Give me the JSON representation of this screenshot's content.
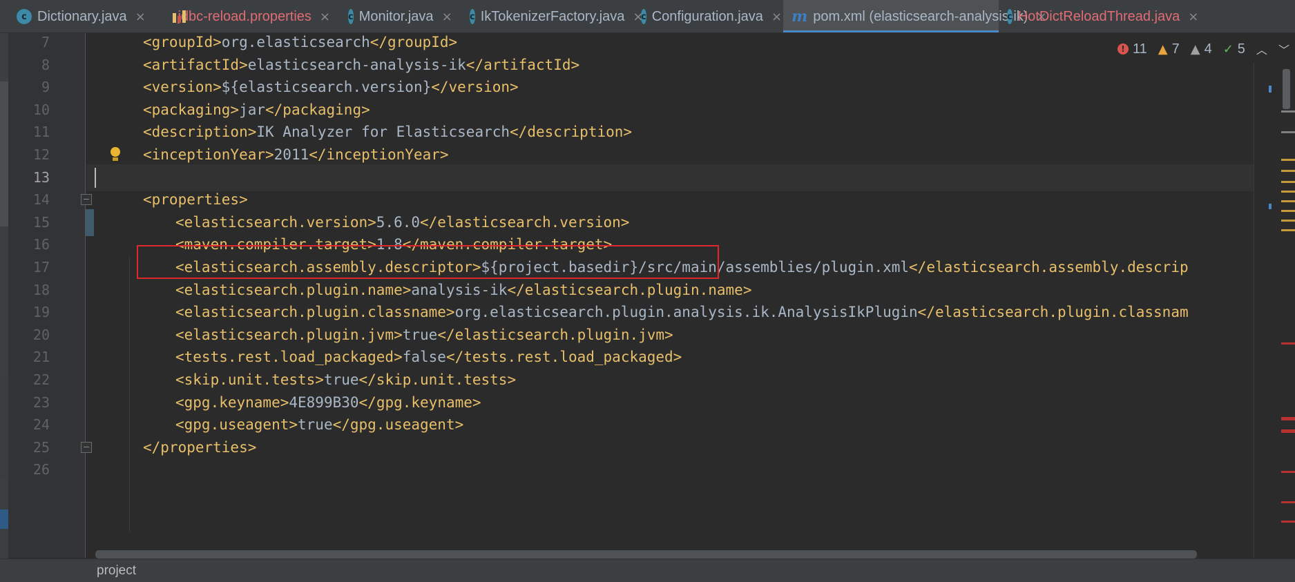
{
  "tabs": [
    {
      "label": "Dictionary.java",
      "icon": "class-icon",
      "active": false,
      "error": false
    },
    {
      "label": "jdbc-reload.properties",
      "icon": "properties-icon",
      "active": false,
      "error": true
    },
    {
      "label": "Monitor.java",
      "icon": "class-icon",
      "active": false,
      "error": false
    },
    {
      "label": "IkTokenizerFactory.java",
      "icon": "class-icon",
      "active": false,
      "error": false
    },
    {
      "label": "Configuration.java",
      "icon": "class-icon",
      "active": false,
      "error": false
    },
    {
      "label": "pom.xml (elasticsearch-analysis-ik)",
      "icon": "maven-icon",
      "active": true,
      "error": false
    },
    {
      "label": "HotDictReloadThread.java",
      "icon": "class-icon",
      "active": false,
      "error": true
    }
  ],
  "tab_close_glyph": "×",
  "inspections": {
    "errors": "11",
    "warnings": "7",
    "weak_warnings": "4",
    "ok": "5"
  },
  "editor": {
    "current_line": 13,
    "lines": [
      {
        "num": "7",
        "indent": 1,
        "parts": [
          [
            "tag",
            "<groupId>"
          ],
          [
            "txt",
            "org.elasticsearch"
          ],
          [
            "tag",
            "</groupId>"
          ]
        ]
      },
      {
        "num": "8",
        "indent": 1,
        "parts": [
          [
            "tag",
            "<artifactId>"
          ],
          [
            "txt",
            "elasticsearch-analysis-ik"
          ],
          [
            "tag",
            "</artifactId>"
          ]
        ]
      },
      {
        "num": "9",
        "indent": 1,
        "parts": [
          [
            "tag",
            "<version>"
          ],
          [
            "txt",
            "${elasticsearch.version}"
          ],
          [
            "tag",
            "</version>"
          ]
        ]
      },
      {
        "num": "10",
        "indent": 1,
        "parts": [
          [
            "tag",
            "<packaging>"
          ],
          [
            "txt",
            "jar"
          ],
          [
            "tag",
            "</packaging>"
          ]
        ]
      },
      {
        "num": "11",
        "indent": 1,
        "parts": [
          [
            "tag",
            "<description>"
          ],
          [
            "txt",
            "IK Analyzer for Elasticsearch"
          ],
          [
            "tag",
            "</description>"
          ]
        ]
      },
      {
        "num": "12",
        "indent": 1,
        "parts": [
          [
            "tag",
            "<inceptionYear>"
          ],
          [
            "txt",
            "2011"
          ],
          [
            "tag",
            "</inceptionYear>"
          ]
        ]
      },
      {
        "num": "13",
        "indent": 0,
        "parts": []
      },
      {
        "num": "14",
        "indent": 1,
        "parts": [
          [
            "tag",
            "<properties>"
          ]
        ]
      },
      {
        "num": "15",
        "indent": 2,
        "parts": [
          [
            "tag",
            "<elasticsearch.version>"
          ],
          [
            "txt",
            "5.6.0"
          ],
          [
            "tag",
            "</elasticsearch.version>"
          ]
        ]
      },
      {
        "num": "16",
        "indent": 2,
        "parts": [
          [
            "tag",
            "<maven.compiler.target>"
          ],
          [
            "txt",
            "1.8"
          ],
          [
            "tag",
            "</maven.compiler.target>"
          ]
        ]
      },
      {
        "num": "17",
        "indent": 2,
        "parts": [
          [
            "tag",
            "<elasticsearch.assembly.descriptor>"
          ],
          [
            "txt",
            "${project.basedir}/src/main/assemblies/plugin.xml"
          ],
          [
            "tag",
            "</elasticsearch.assembly.descrip"
          ]
        ]
      },
      {
        "num": "18",
        "indent": 2,
        "parts": [
          [
            "tag",
            "<elasticsearch.plugin.name>"
          ],
          [
            "txt",
            "analysis-ik"
          ],
          [
            "tag",
            "</elasticsearch.plugin.name>"
          ]
        ]
      },
      {
        "num": "19",
        "indent": 2,
        "parts": [
          [
            "tag",
            "<elasticsearch.plugin.classname>"
          ],
          [
            "txt",
            "org.elasticsearch.plugin.analysis.ik.AnalysisIkPlugin"
          ],
          [
            "tag",
            "</elasticsearch.plugin.classnam"
          ]
        ]
      },
      {
        "num": "20",
        "indent": 2,
        "parts": [
          [
            "tag",
            "<elasticsearch.plugin.jvm>"
          ],
          [
            "txt",
            "true"
          ],
          [
            "tag",
            "</elasticsearch.plugin.jvm>"
          ]
        ]
      },
      {
        "num": "21",
        "indent": 2,
        "parts": [
          [
            "tag",
            "<tests.rest.load_packaged>"
          ],
          [
            "txt",
            "false"
          ],
          [
            "tag",
            "</tests.rest.load_packaged>"
          ]
        ]
      },
      {
        "num": "22",
        "indent": 2,
        "parts": [
          [
            "tag",
            "<skip.unit.tests>"
          ],
          [
            "txt",
            "true"
          ],
          [
            "tag",
            "</skip.unit.tests>"
          ]
        ]
      },
      {
        "num": "23",
        "indent": 2,
        "parts": [
          [
            "tag",
            "<gpg.keyname>"
          ],
          [
            "txt",
            "4E899B30"
          ],
          [
            "tag",
            "</gpg.keyname>"
          ]
        ]
      },
      {
        "num": "24",
        "indent": 2,
        "parts": [
          [
            "tag",
            "<gpg.useagent>"
          ],
          [
            "txt",
            "true"
          ],
          [
            "tag",
            "</gpg.useagent>"
          ]
        ]
      },
      {
        "num": "25",
        "indent": 1,
        "parts": [
          [
            "tag",
            "</properties>"
          ]
        ]
      },
      {
        "num": "26",
        "indent": 0,
        "parts": []
      }
    ]
  },
  "breadcrumb": "project",
  "colors": {
    "background": "#2b2b2b",
    "tag": "#e8bf6a",
    "text": "#a9b7c6",
    "highlight_box": "#e0272d",
    "active_tab_underline": "#4a88c7"
  }
}
